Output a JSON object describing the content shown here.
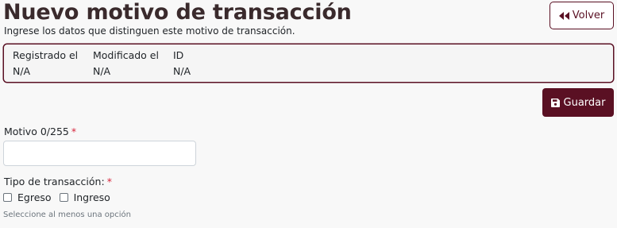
{
  "header": {
    "title": "Nuevo motivo de transacción",
    "subtitle": "Ingrese los datos que distinguen este motivo de transacción.",
    "back_label": "Volver"
  },
  "meta": {
    "registered": {
      "label": "Registrado el",
      "value": "N/A"
    },
    "modified": {
      "label": "Modificado el",
      "value": "N/A"
    },
    "id": {
      "label": "ID",
      "value": "N/A"
    }
  },
  "actions": {
    "save_label": "Guardar"
  },
  "form": {
    "motivo": {
      "label": "Motivo 0/255",
      "required_mark": "*",
      "value": "",
      "placeholder": ""
    },
    "tipo": {
      "label": "Tipo de transacción:",
      "required_mark": "*",
      "options": [
        {
          "label": "Egreso",
          "checked": false
        },
        {
          "label": "Ingreso",
          "checked": false
        }
      ],
      "help": "Seleccione al menos una opción"
    }
  },
  "colors": {
    "accent": "#5a1023",
    "required": "#d7263d",
    "background": "#f8f8f8"
  }
}
